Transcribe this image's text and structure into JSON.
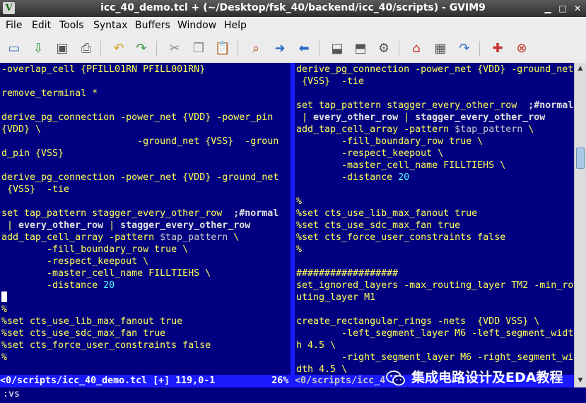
{
  "window": {
    "title": "icc_40_demo.tcl + (~/Desktop/fsk_40/backend/icc_40/scripts) - GVIM9",
    "app_icon": "vim-icon"
  },
  "menu": [
    "File",
    "Edit",
    "Tools",
    "Syntax",
    "Buffers",
    "Window",
    "Help"
  ],
  "toolbar": [
    {
      "name": "open-icon",
      "color": "#3a6fb5"
    },
    {
      "name": "save-icon",
      "color": "#3a9a3a"
    },
    {
      "name": "save-as-icon",
      "color": "#555555"
    },
    {
      "name": "print-icon",
      "color": "#666666"
    },
    {
      "name": "undo-icon",
      "color": "#d4a017"
    },
    {
      "name": "redo-icon",
      "color": "#3a9a3a"
    },
    {
      "name": "cut-icon",
      "color": "#888888"
    },
    {
      "name": "copy-icon",
      "color": "#888888"
    },
    {
      "name": "paste-icon",
      "color": "#b8860b"
    },
    {
      "name": "find-replace-icon",
      "color": "#b84a1a"
    },
    {
      "name": "find-next-icon",
      "color": "#2a6ac8"
    },
    {
      "name": "find-prev-icon",
      "color": "#2a6ac8"
    },
    {
      "name": "load-session-icon",
      "color": "#555555"
    },
    {
      "name": "save-session-icon",
      "color": "#555555"
    },
    {
      "name": "run-script-icon",
      "color": "#555555"
    },
    {
      "name": "make-icon",
      "color": "#c83030"
    },
    {
      "name": "build-tags-icon",
      "color": "#555555"
    },
    {
      "name": "jump-tag-icon",
      "color": "#2a6ac8"
    },
    {
      "name": "help-icon",
      "color": "#c83030"
    },
    {
      "name": "find-help-icon",
      "color": "#c83030"
    }
  ],
  "left_pane": {
    "lines": [
      "-overlap_cell {PFILL01RN PFILL001RN}",
      "",
      "remove_terminal *",
      "",
      "derive_pg_connection -power_net {VDD} -power_pin",
      "{VDD} \\",
      "                        -ground_net {VSS}  -groun",
      "d_pin {VSS}",
      "",
      "derive_pg_connection -power_net {VDD} -ground_net",
      " {VSS}  -tie",
      "",
      "set tap_pattern stagger_every_other_row  ;#normal",
      " | every_other_row | stagger_every_other_row",
      "add_tap_cell_array -pattern $tap_pattern \\",
      "        -fill_boundary_row true \\",
      "        -respect_keepout \\",
      "        -master_cell_name FILLTIEHS \\",
      "        -distance 20",
      "",
      "%",
      "%set cts_use_lib_max_fanout true",
      "%set cts_use_sdc_max_fan true",
      "%set cts_force_user_constraints false",
      "%"
    ],
    "status": "<0/scripts/icc_40_demo.tcl [+] 119,0-1          26%"
  },
  "right_pane": {
    "lines": [
      "derive_pg_connection -power_net {VDD} -ground_net",
      " {VSS}  -tie",
      "",
      "set tap_pattern stagger_every_other_row  ;#normal",
      " | every_other_row | stagger_every_other_row",
      "add_tap_cell_array -pattern $tap_pattern \\",
      "        -fill_boundary_row true \\",
      "        -respect_keepout \\",
      "        -master_cell_name FILLTIEHS \\",
      "        -distance 20",
      "",
      "%",
      "%set cts_use_lib_max_fanout true",
      "%set cts_use_sdc_max_fan true",
      "%set cts_force_user_constraints false",
      "%",
      "",
      "##################",
      "set_ignored_layers -max_routing_layer TM2 -min_ro",
      "uting_layer M1",
      "",
      "create_rectangular_rings -nets  {VDD VSS} \\",
      "        -left_segment_layer M6 -left_segment_widt",
      "h 4.5 \\",
      "        -right_segment_layer M6 -right_segment_wi",
      "dth 4.5 \\"
    ],
    "status": "<0/scripts/icc_4"
  },
  "cmdline": ":vs",
  "watermark": "集成电路设计及EDA教程",
  "colors": {
    "background": "#000080",
    "text": "#ffff55",
    "keyword": "#e0e0e0",
    "number": "#55ffff",
    "statusbar": "#1a1aff"
  }
}
